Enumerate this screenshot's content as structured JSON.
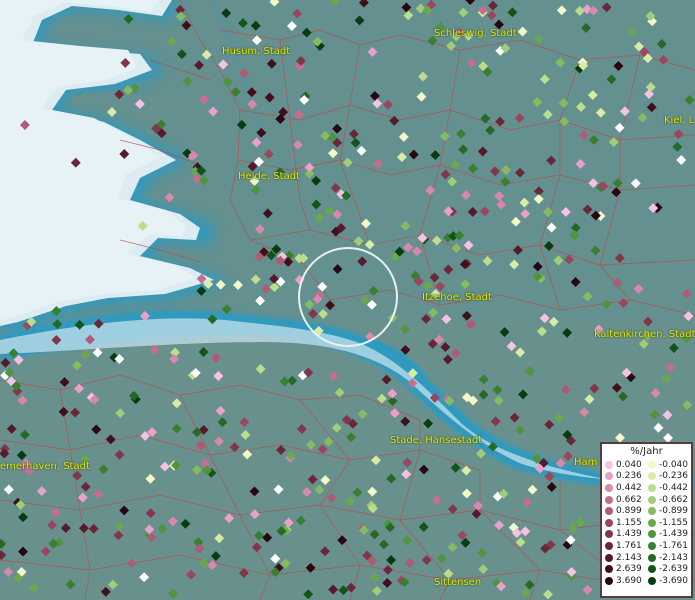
{
  "map": {
    "places": [
      {
        "name": "Husum, Stadt"
      },
      {
        "name": "Schleswig, Stadt"
      },
      {
        "name": "Kiel, L"
      },
      {
        "name": "Heide, Stadt"
      },
      {
        "name": "Itzehoe, Stadt"
      },
      {
        "name": "Kaltenkirchen, Stadt"
      },
      {
        "name": "emerhaven, Stadt"
      },
      {
        "name": "Stade, Hansestadt"
      },
      {
        "name": "Ham"
      },
      {
        "name": "Sittensen"
      }
    ]
  },
  "legend": {
    "title": "%/Jahr",
    "positive": [
      "0.040",
      "0.236",
      "0.442",
      "0.662",
      "0.899",
      "1.155",
      "1.439",
      "1.761",
      "2.143",
      "2.639",
      "3.690"
    ],
    "negative": [
      "-0.040",
      "-0.236",
      "-0.442",
      "-0.662",
      "-0.899",
      "-1.155",
      "-1.439",
      "-1.761",
      "-2.143",
      "-2.639",
      "-3.690"
    ],
    "positive_colors": [
      "#f6c2e4",
      "#eaa0c8",
      "#d987ac",
      "#c56f8e",
      "#b05a75",
      "#99465e",
      "#82364a",
      "#6b2738",
      "#561a2a",
      "#3f0f1c",
      "#2a0610"
    ],
    "negative_colors": [
      "#f2f8c6",
      "#d8eca6",
      "#bcdd8c",
      "#a1cd76",
      "#85bb61",
      "#6aa84e",
      "#50943e",
      "#397f30",
      "#256a24",
      "#125419",
      "#053d10"
    ]
  }
}
